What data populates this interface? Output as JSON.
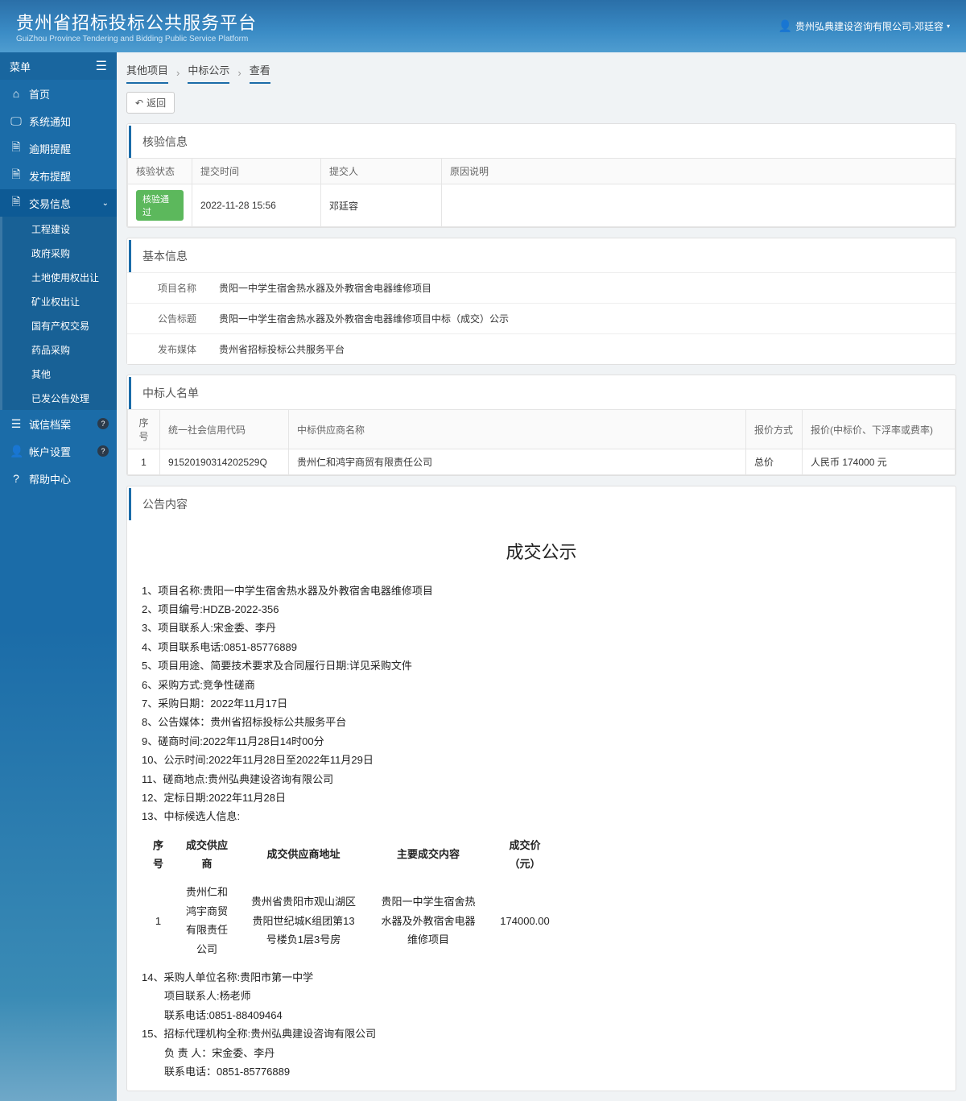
{
  "header": {
    "title_cn": "贵州省招标投标公共服务平台",
    "title_en": "GuiZhou Province Tendering and Bidding Public Service Platform",
    "user": "贵州弘典建设咨询有限公司-邓廷容"
  },
  "sidebar": {
    "menu_label": "菜单",
    "items": [
      {
        "icon": "⌂",
        "label": "首页"
      },
      {
        "icon": "🖵",
        "label": "系统通知"
      },
      {
        "icon": "🗎",
        "label": "逾期提醒"
      },
      {
        "icon": "🗎",
        "label": "发布提醒"
      },
      {
        "icon": "🗎",
        "label": "交易信息",
        "active": true
      }
    ],
    "sub": [
      "工程建设",
      "政府采购",
      "土地使用权出让",
      "矿业权出让",
      "国有产权交易",
      "药品采购",
      "其他",
      "已发公告处理"
    ],
    "items2": [
      {
        "icon": "☰",
        "label": "诚信档案",
        "badge": "?"
      },
      {
        "icon": "👤",
        "label": "帐户设置",
        "badge": "?"
      },
      {
        "icon": "?",
        "label": "帮助中心"
      }
    ]
  },
  "breadcrumb": [
    "其他项目",
    "中标公示",
    "查看"
  ],
  "back_label": "返回",
  "panel_verify": {
    "title": "核验信息",
    "headers": [
      "核验状态",
      "提交时间",
      "提交人",
      "原因说明"
    ],
    "row": {
      "status": "核验通过",
      "time": "2022-11-28 15:56",
      "submitter": "邓廷容",
      "reason": ""
    }
  },
  "panel_basic": {
    "title": "基本信息",
    "rows": [
      {
        "label": "项目名称",
        "value": "贵阳一中学生宿舍热水器及外教宿舍电器维修项目"
      },
      {
        "label": "公告标题",
        "value": "贵阳一中学生宿舍热水器及外教宿舍电器维修项目中标（成交）公示"
      },
      {
        "label": "发布媒体",
        "value": "贵州省招标投标公共服务平台"
      }
    ]
  },
  "panel_bidder": {
    "title": "中标人名单",
    "headers": [
      "序号",
      "统一社会信用代码",
      "中标供应商名称",
      "报价方式",
      "报价(中标价、下浮率或费率)"
    ],
    "row": {
      "no": "1",
      "code": "91520190314202529Q",
      "name": "贵州仁和鸿宇商贸有限责任公司",
      "method": "总价",
      "price": "人民币 174000 元"
    }
  },
  "panel_notice": {
    "title": "公告内容",
    "doc_title": "成交公示",
    "lines": [
      "1、项目名称:贵阳一中学生宿舍热水器及外教宿舍电器维修项目",
      "2、项目编号:HDZB-2022-356",
      "3、项目联系人:宋金委、李丹",
      "4、项目联系电话:0851-85776889",
      "5、项目用途、简要技术要求及合同履行日期:详见采购文件",
      "6、采购方式:竞争性磋商",
      "7、采购日期：2022年11月17日",
      "8、公告媒体：贵州省招标投标公共服务平台",
      "9、磋商时间:2022年11月28日14时00分",
      "10、公示时间:2022年11月28日至2022年11月29日",
      "11、磋商地点:贵州弘典建设咨询有限公司",
      "12、定标日期:2022年11月28日",
      "13、中标候选人信息:"
    ],
    "table": {
      "headers": [
        "序号",
        "成交供应商",
        "成交供应商地址",
        "主要成交内容",
        "成交价（元）"
      ],
      "row": [
        "1",
        "贵州仁和鸿宇商贸有限责任公司",
        "贵州省贵阳市观山湖区贵阳世纪城K组团第13号楼负1层3号房",
        "贵阳一中学生宿舍热水器及外教宿舍电器维修项目",
        "174000.00"
      ]
    },
    "lines2": [
      "14、采购人单位名称:贵阳市第一中学",
      "项目联系人:杨老师",
      "联系电话:0851-88409464",
      "15、招标代理机构全称:贵州弘典建设咨询有限公司",
      "负 责 人：宋金委、李丹",
      "联系电话：0851-85776889"
    ]
  }
}
